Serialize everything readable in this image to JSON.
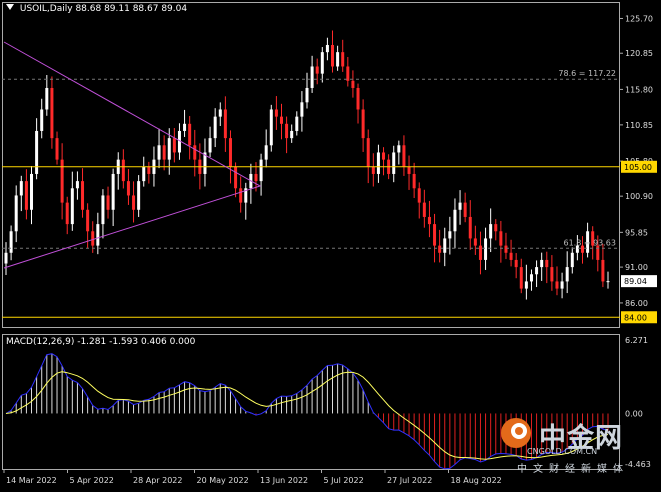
{
  "header": {
    "symbol": "USOIL,Daily",
    "ohlc": "88.68 89.11 88.67 89.04"
  },
  "macd": {
    "label": "MACD(12,26,9) -1.281 -1.593 0.406 0.000",
    "scale_top": "6.271",
    "scale_zero": "0.00",
    "scale_bottom": "-4.463"
  },
  "price_axis": {
    "ticks": [
      "125.70",
      "120.85",
      "115.80",
      "110.85",
      "105.80",
      "100.90",
      "95.85",
      "91.00",
      "86.00"
    ],
    "current_price": "89.04",
    "hline_105": "105.00",
    "hline_84": "84.00",
    "fib_786": "78.6 = 117.22",
    "fib_618": "61.8 = 93.63"
  },
  "time_axis": {
    "labels": [
      "14 Mar 2022",
      "5 Apr 2022",
      "28 Apr 2022",
      "20 May 2022",
      "13 Jun 2022",
      "5 Jul 2022",
      "27 Jul 2022",
      "18 Aug 2022"
    ]
  },
  "watermark": {
    "cn": "中金网",
    "url": "CNGOLD.COM.CN",
    "sub": "中文财经新媒体"
  },
  "colors": {
    "bull": "#ffffff",
    "bear": "#ff2a2a",
    "hline": "#ffd700",
    "triangle": "#c050d8",
    "macd_main": "#3030ff",
    "macd_signal": "#ffff60",
    "grid": "#777777"
  },
  "chart_data": {
    "type": "candlestick",
    "ylim": [
      82.5,
      128
    ],
    "closes": [
      93,
      96,
      101,
      103,
      99,
      104,
      110,
      113,
      116,
      109,
      106,
      100,
      97,
      102,
      103,
      99,
      96,
      94,
      97,
      101,
      99,
      104,
      106,
      103,
      101,
      99,
      103,
      105,
      104,
      106,
      108,
      106,
      109,
      107,
      110,
      111,
      108,
      106,
      104,
      107,
      109,
      112,
      113,
      109,
      105,
      102,
      100,
      102,
      104,
      103,
      106,
      108,
      113,
      112,
      111,
      109,
      110,
      112,
      114,
      116,
      119,
      118,
      121,
      122,
      119,
      121,
      119,
      117,
      116,
      113,
      109,
      105,
      104,
      107,
      106,
      104,
      107,
      108,
      105,
      104,
      102,
      100,
      98,
      97,
      94,
      93,
      95,
      96,
      99,
      100,
      98,
      95,
      94,
      92,
      95,
      97,
      96,
      94,
      93,
      92,
      91,
      88,
      89,
      90,
      91,
      92,
      91,
      89,
      88,
      89,
      91,
      93,
      94,
      93,
      96,
      94,
      92,
      89,
      89.04
    ],
    "hlines": [
      105.0,
      84.0
    ],
    "fib_levels": [
      {
        "label": "78.6",
        "value": 117.22
      },
      {
        "label": "61.8",
        "value": 93.63
      }
    ],
    "macd_ylim": [
      -4.463,
      6.271
    ]
  }
}
